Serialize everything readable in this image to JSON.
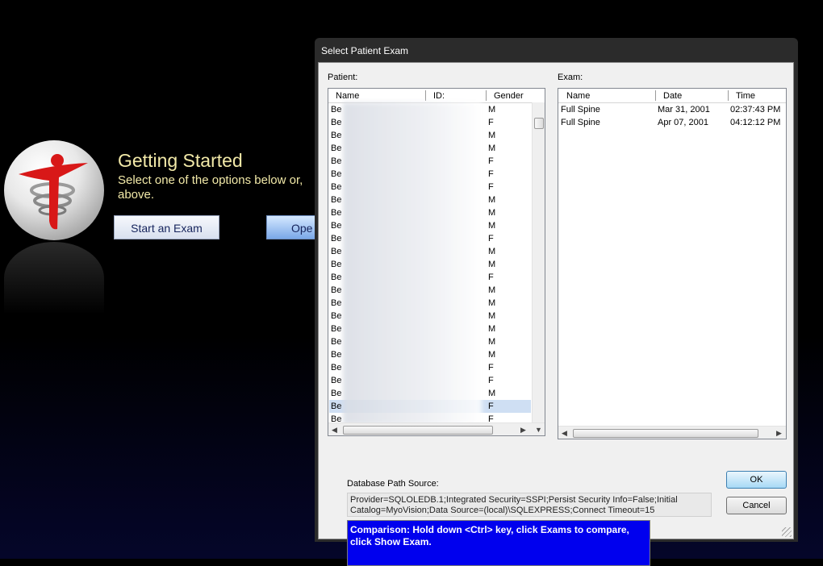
{
  "app": {
    "heading": "Getting Started",
    "subtext": "Select one of the options below or, above.",
    "start_exam_button": "Start an Exam",
    "open_button": "Ope"
  },
  "dialog": {
    "title": "Select Patient Exam",
    "patient_label": "Patient:",
    "exam_label": "Exam:",
    "patient_columns": [
      "Name",
      "ID:",
      "Gender"
    ],
    "patients": [
      {
        "name": "Be",
        "gender": "M"
      },
      {
        "name": "Be",
        "gender": "F"
      },
      {
        "name": "Be",
        "gender": "M"
      },
      {
        "name": "Be",
        "gender": "M"
      },
      {
        "name": "Be",
        "gender": "F"
      },
      {
        "name": "Be",
        "gender": "F"
      },
      {
        "name": "Be",
        "gender": "F"
      },
      {
        "name": "Be",
        "gender": "M"
      },
      {
        "name": "Be",
        "gender": "M"
      },
      {
        "name": "Be",
        "gender": "M"
      },
      {
        "name": "Be",
        "gender": "F"
      },
      {
        "name": "Be",
        "gender": "M"
      },
      {
        "name": "Be",
        "gender": "M"
      },
      {
        "name": "Be",
        "gender": "F"
      },
      {
        "name": "Be",
        "gender": "M"
      },
      {
        "name": "Be",
        "gender": "M"
      },
      {
        "name": "Be",
        "gender": "M"
      },
      {
        "name": "Be",
        "gender": "M"
      },
      {
        "name": "Be",
        "gender": "M"
      },
      {
        "name": "Be",
        "gender": "M"
      },
      {
        "name": "Be",
        "gender": "F"
      },
      {
        "name": "Be",
        "gender": "F"
      },
      {
        "name": "Be",
        "gender": "M"
      },
      {
        "name": "Be",
        "gender": "F",
        "selected": true
      },
      {
        "name": "Be",
        "gender": "F"
      }
    ],
    "exam_columns": [
      "Name",
      "Date",
      "Time"
    ],
    "exams": [
      {
        "name": "Full Spine",
        "date": "Mar 31, 2001",
        "time": "02:37:43 PM"
      },
      {
        "name": "Full Spine",
        "date": "Apr 07, 2001",
        "time": "04:12:12 PM"
      }
    ],
    "db_label": "Database Path Source:",
    "db_value": "Provider=SQLOLEDB.1;Integrated Security=SSPI;Persist Security Info=False;Initial Catalog=MyoVision;Data Source=(local)\\SQLEXPRESS;Connect Timeout=15",
    "comparison_note": "Comparison: Hold down <Ctrl> key, click Exams to compare, click Show Exam.",
    "ok_button": "OK",
    "cancel_button": "Cancel"
  },
  "colors": {
    "heading_text": "#f2e9a8",
    "note_background": "#0000ee",
    "selection": "#cfdff3"
  }
}
